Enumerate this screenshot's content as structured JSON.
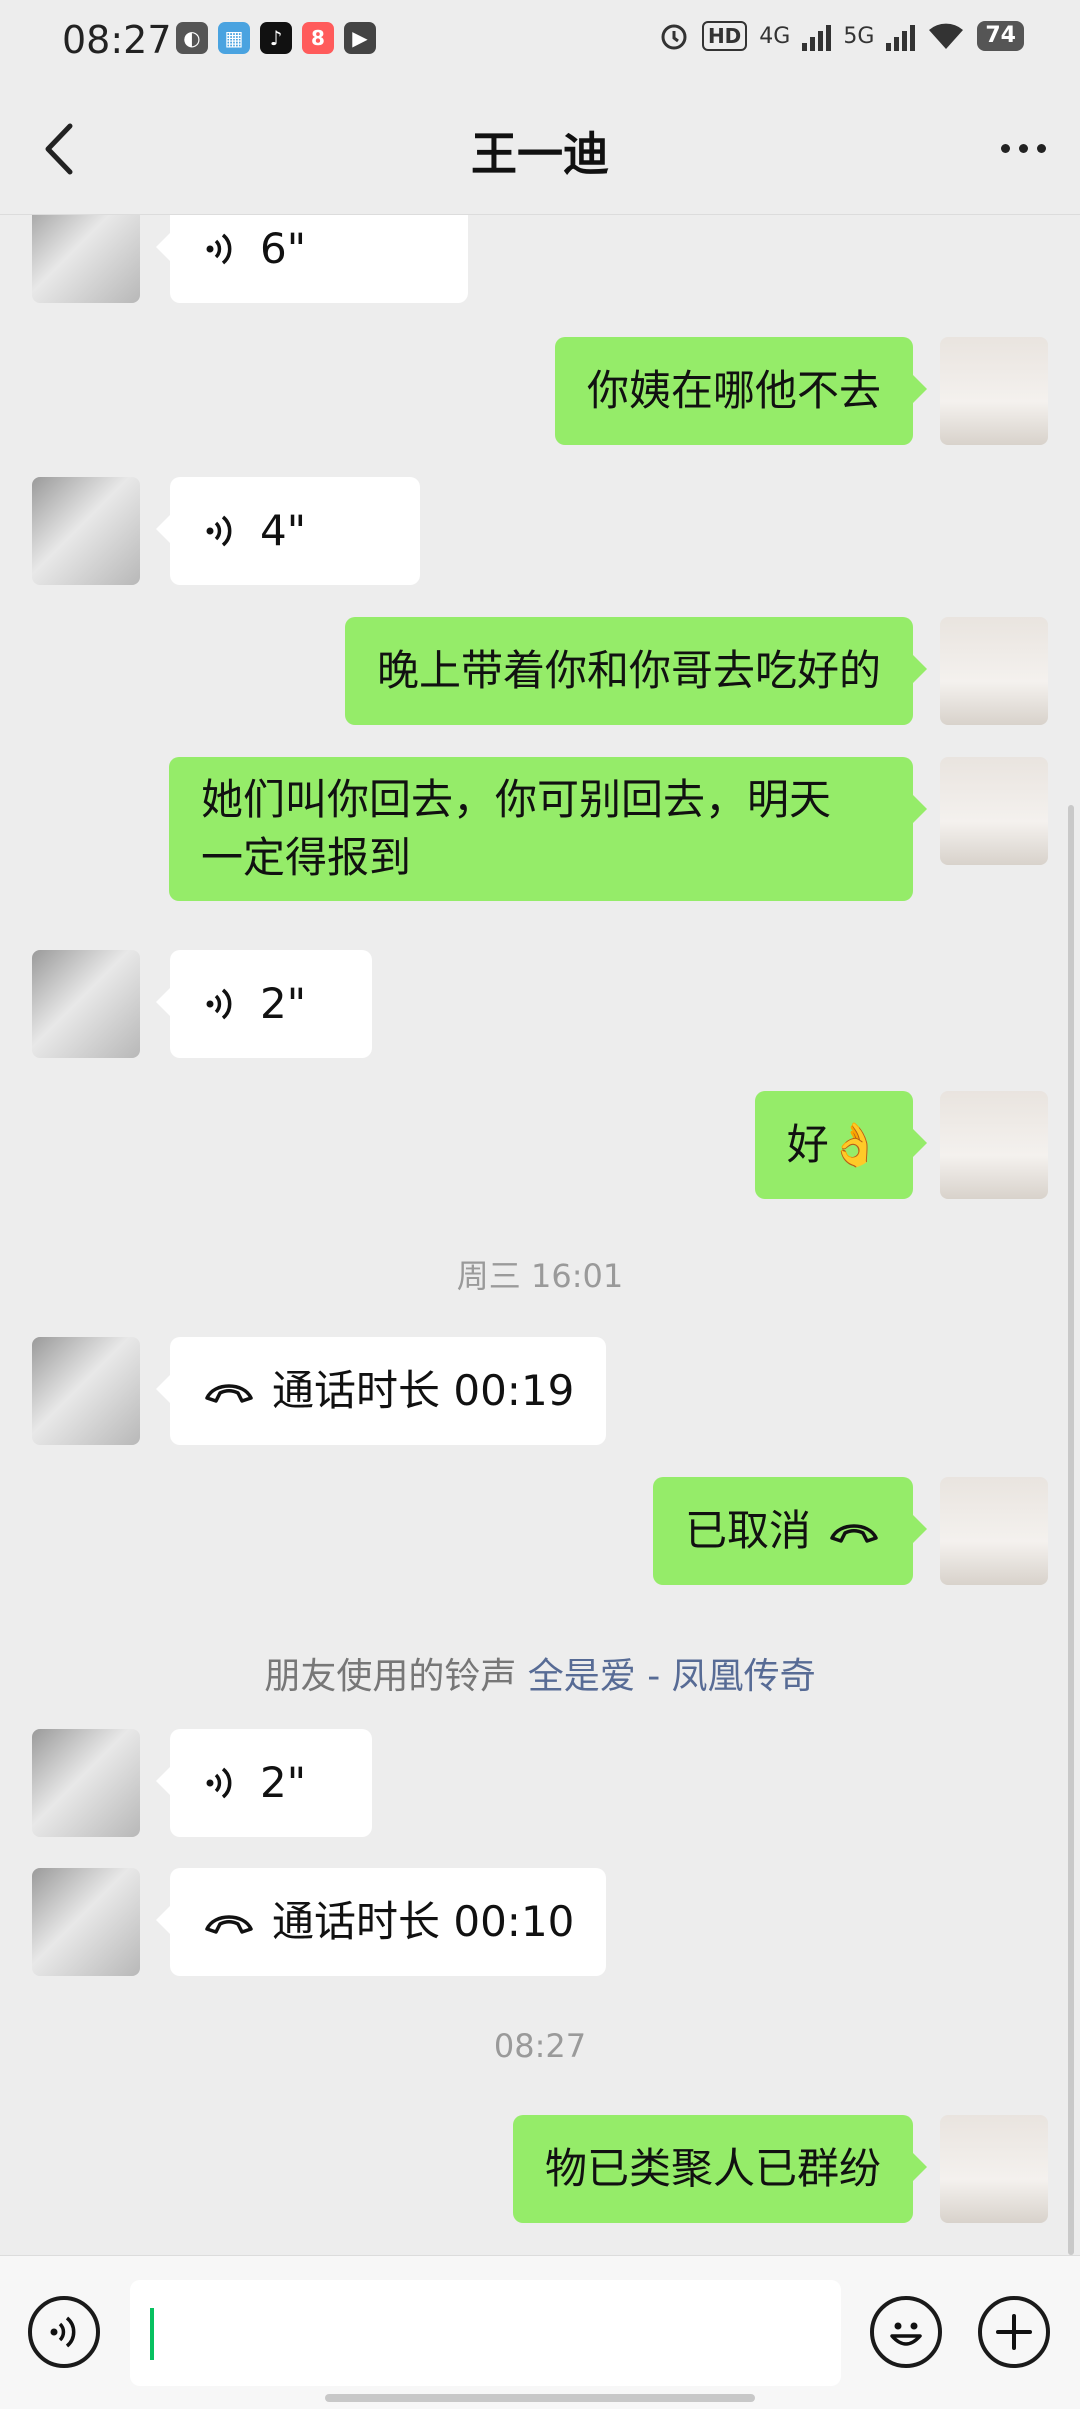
{
  "status_bar": {
    "time": "08:27",
    "network_1": "4G",
    "network_2": "5G",
    "hd_label": "HD",
    "battery": "74"
  },
  "header": {
    "title": "王一迪"
  },
  "messages": {
    "m1_voice": "6\"",
    "m2_text": "你姨在哪他不去",
    "m3_voice": "4\"",
    "m4_text": "晚上带着你和你哥去吃好的",
    "m5_text_line1": "她们叫你回去，你可别回去，明天",
    "m5_text_line2": "一定得报到",
    "m6_voice": "2\"",
    "m7_text": "好👌",
    "time_1": "周三 16:01",
    "m8_call": "通话时长 00:19",
    "m9_call": "已取消",
    "ringtone_prefix": "朋友使用的铃声",
    "ringtone_song": "全是爱 - 凤凰传奇",
    "m10_voice": "2\"",
    "m11_call": "通话时长 00:10",
    "time_2": "08:27",
    "m12_text": "物已类聚人已群纷"
  },
  "icons": {
    "voice_input": "voice-input-icon",
    "emoji": "emoji-icon",
    "add": "add-icon"
  },
  "colors": {
    "sent_bubble": "#95ec69",
    "received_bubble": "#ffffff",
    "background": "#ededed",
    "link": "#576b95",
    "caret": "#07c160"
  }
}
